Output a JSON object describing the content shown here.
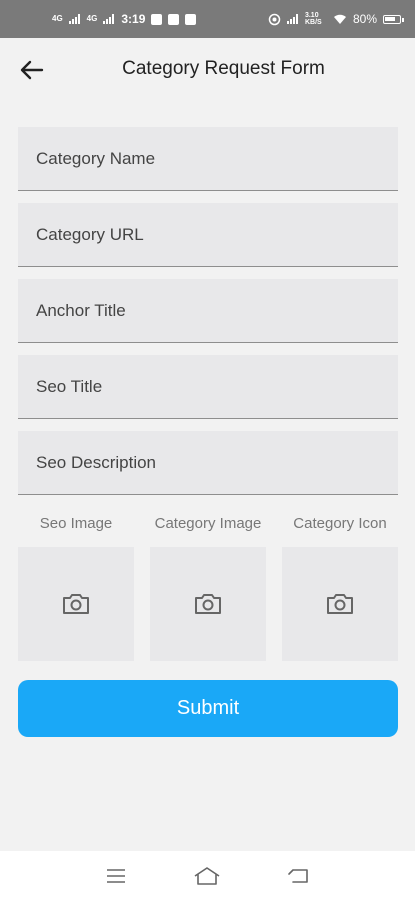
{
  "status_bar": {
    "signal1": "4G",
    "signal2": "4G",
    "time": "3:19",
    "data_speed": "3.10 KB/S",
    "battery_level": "80%",
    "battery_fraction": 0.8
  },
  "header": {
    "title": "Category Request Form",
    "back_icon": "arrow-left-icon"
  },
  "form": {
    "fields": [
      {
        "placeholder": "Category Name"
      },
      {
        "placeholder": "Category URL"
      },
      {
        "placeholder": "Anchor Title"
      },
      {
        "placeholder": "Seo Title"
      },
      {
        "placeholder": "Seo Description"
      }
    ],
    "images": [
      {
        "label": "Seo Image",
        "icon": "camera-icon"
      },
      {
        "label": "Category Image",
        "icon": "camera-icon"
      },
      {
        "label": "Category Icon",
        "icon": "camera-icon"
      }
    ],
    "submit_label": "Submit"
  },
  "colors": {
    "accent": "#1aa8f7",
    "status_bar_bg": "#7a7a7a",
    "field_bg": "#e8e8ea",
    "page_bg": "#f2f2f2"
  },
  "nav": {
    "menu_icon": "menu-icon",
    "home_icon": "home-icon",
    "back_icon": "return-icon"
  }
}
